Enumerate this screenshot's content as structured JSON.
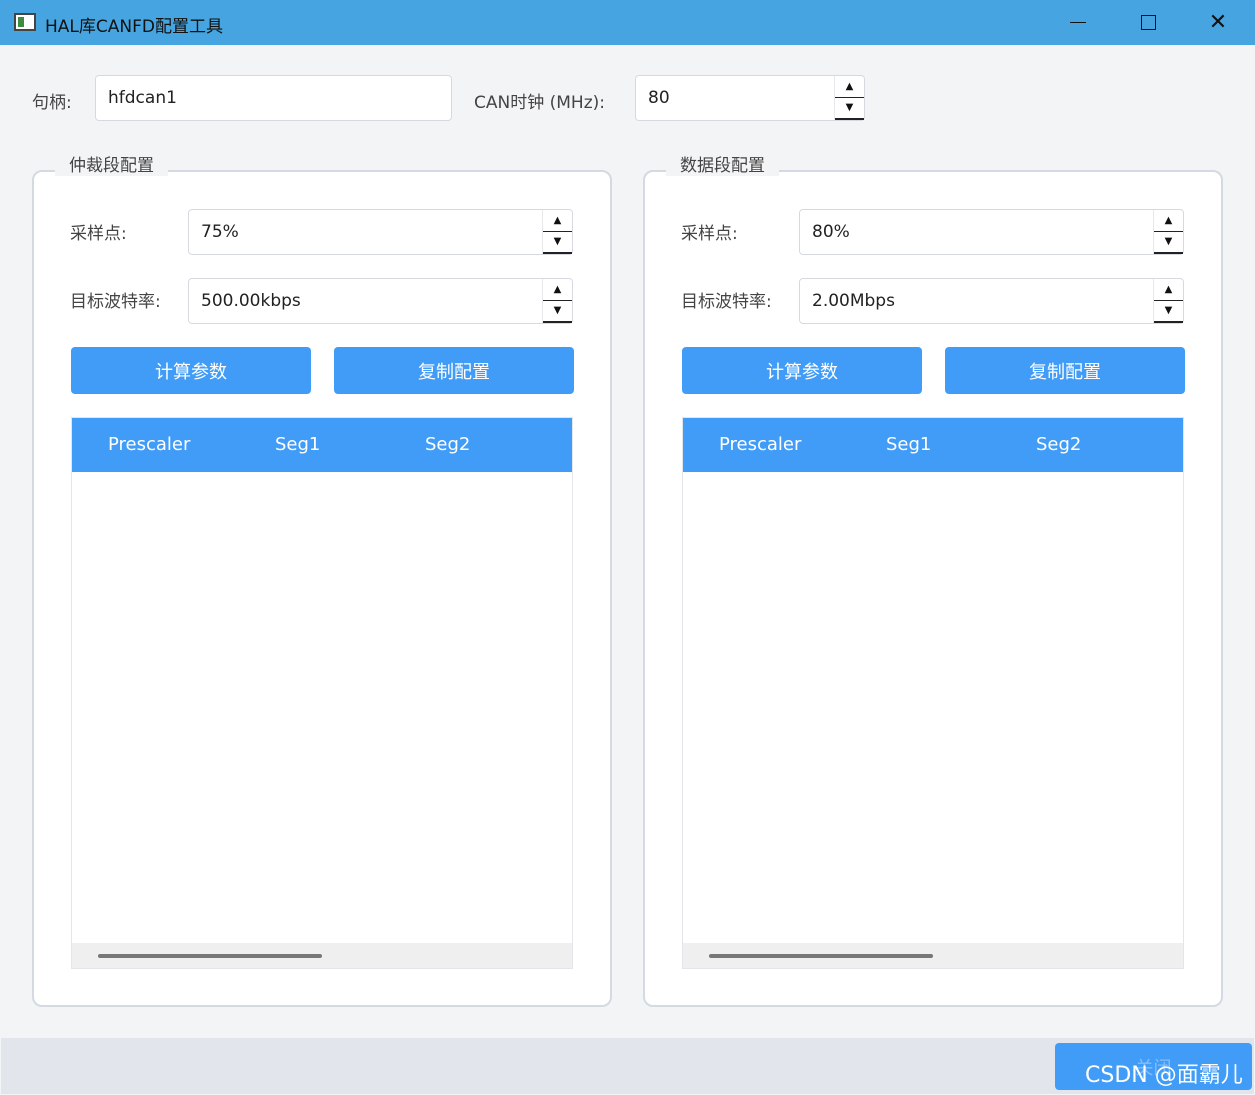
{
  "window": {
    "title": "HAL库CANFD配置工具",
    "minimize_icon": "minimize-icon",
    "maximize_icon": "maximize-icon",
    "close_glyph": "✕"
  },
  "top": {
    "handle_label": "句柄:",
    "handle_value": "hfdcan1",
    "clock_label": "CAN时钟 (MHz):",
    "clock_value": "80"
  },
  "spin": {
    "up": "▲",
    "down": "▼"
  },
  "arbitration": {
    "title": "仲裁段配置",
    "sample_label": "采样点:",
    "sample_value": "75%",
    "baud_label": "目标波特率:",
    "baud_value": "500.00kbps",
    "calc_button": "计算参数",
    "copy_button": "复制配置",
    "columns": [
      "Prescaler",
      "Seg1",
      "Seg2"
    ],
    "rows": []
  },
  "data_phase": {
    "title": "数据段配置",
    "sample_label": "采样点:",
    "sample_value": "80%",
    "baud_label": "目标波特率:",
    "baud_value": "2.00Mbps",
    "calc_button": "计算参数",
    "copy_button": "复制配置",
    "columns": [
      "Prescaler",
      "Seg1",
      "Seg2"
    ],
    "rows": []
  },
  "footer": {
    "close_button": "关闭",
    "watermark": "CSDN @面霸儿"
  },
  "colors": {
    "titlebar": "#46a5e0",
    "accent": "#409cf7",
    "background": "#f3f4f6"
  }
}
